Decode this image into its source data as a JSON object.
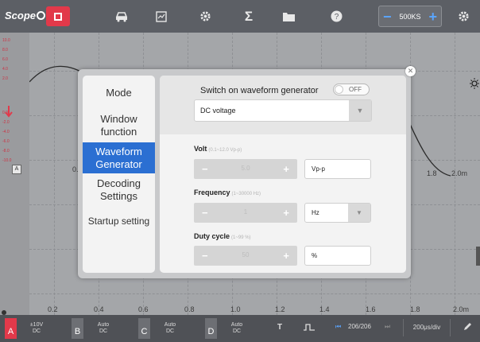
{
  "app": {
    "title": "Scope"
  },
  "toolbar": {
    "icons": [
      "stop-icon",
      "car-icon",
      "chart-icon",
      "gear-icon",
      "sigma-icon",
      "folder-icon",
      "help-icon"
    ],
    "sample": {
      "minus": "−",
      "value": "500KS",
      "plus": "+"
    }
  },
  "plot": {
    "x_ticks_top": [
      "0.2",
      "1.8",
      "2.0m"
    ],
    "x_ticks_bottom": [
      "0.2",
      "0.4",
      "0.6",
      "0.8",
      "1.0",
      "1.2",
      "1.4",
      "1.6",
      "1.8",
      "2.0m"
    ],
    "y_ticks": [
      "10.0",
      "8.0",
      "6.0",
      "4.0",
      "2.0",
      "0.0",
      "-2.0",
      "-4.0",
      "-6.0",
      "-8.0",
      "-10.0"
    ],
    "channel_marker_label": "A",
    "colors": {
      "channel_a": "#e2394a",
      "accent": "#2b6fd2"
    }
  },
  "dialog": {
    "menu": [
      {
        "label": "Mode"
      },
      {
        "label": "Window function"
      },
      {
        "label": "Waveform Generator"
      },
      {
        "label": "Decoding Settings"
      },
      {
        "label": "Startup setting"
      }
    ],
    "active_index": 2,
    "switch_label": "Switch on waveform generator",
    "switch_state": "OFF",
    "waveform_select": "DC voltage",
    "volt": {
      "label": "Volt",
      "hint": "(0.1~12.0 Vp-p)",
      "minus": "−",
      "value": "5.0",
      "plus": "+",
      "unit": "Vp-p"
    },
    "frequency": {
      "label": "Frequency",
      "hint": "(1~30000 Hz)",
      "minus": "−",
      "value": "1",
      "plus": "+",
      "unit": "Hz"
    },
    "duty": {
      "label": "Duty cycle",
      "hint": "(1~99 %)",
      "minus": "−",
      "value": "50",
      "plus": "+",
      "unit": "%"
    }
  },
  "bottombar": {
    "channels": [
      {
        "tag": "A",
        "line1": "±10V",
        "line2": "DC",
        "color": "#e2394a"
      },
      {
        "tag": "B",
        "line1": "Auto",
        "line2": "DC",
        "color": "#6d6f74"
      },
      {
        "tag": "C",
        "line1": "Auto",
        "line2": "DC",
        "color": "#6d6f74"
      },
      {
        "tag": "D",
        "line1": "Auto",
        "line2": "DC",
        "color": "#6d6f74"
      }
    ],
    "trigger": "T",
    "page": "206/206",
    "timebase": "200μs/div"
  }
}
